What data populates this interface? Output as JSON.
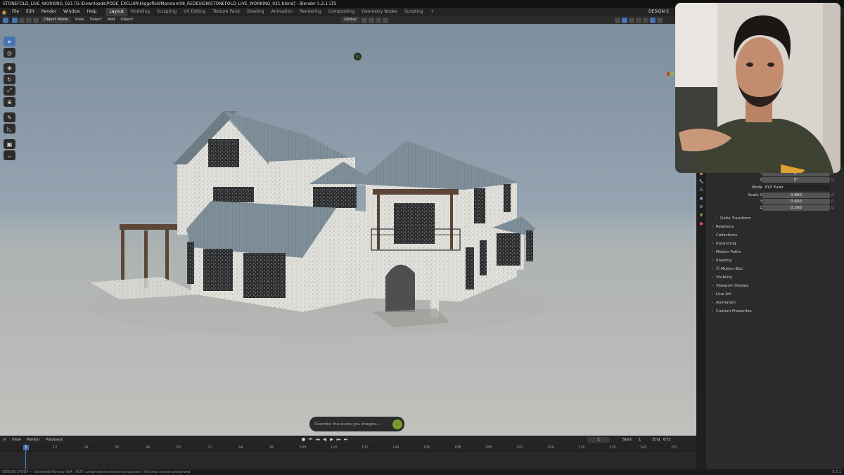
{
  "window": {
    "title": "STONEFOLD_LIVE_WORKING_021 [G:\\Downloads\\PODE_EXCLUIR\\HiggsfieldMansion\\08_REDESIGN\\STONEFOLD_LIVE_WORKING_021.blend] - Blender 5.2.1 LTS"
  },
  "menu": {
    "items": [
      "File",
      "Edit",
      "Render",
      "Window",
      "Help"
    ],
    "workspaces": [
      "Layout",
      "Modeling",
      "Sculpting",
      "UV Editing",
      "Texture Paint",
      "Shading",
      "Animation",
      "Rendering",
      "Compositing",
      "Geometry Nodes",
      "Scripting"
    ],
    "active_workspace": "Layout",
    "add_tab": "+",
    "right_label": "DESIGN S"
  },
  "viewport_header": {
    "mode": "Object Mode",
    "menus": [
      "View",
      "Select",
      "Add",
      "Object"
    ],
    "orientation": "Global"
  },
  "prompt": {
    "placeholder": "Describe the scene you imagine...",
    "submit_icon": "arrow-right-icon"
  },
  "timeline": {
    "menus": [
      "View",
      "Marker",
      "Playback"
    ],
    "current_frame": "1",
    "start_label": "Start",
    "start": "1",
    "end_label": "End",
    "end": "673",
    "ticks": [
      "1",
      "12",
      "24",
      "36",
      "48",
      "60",
      "72",
      "84",
      "96",
      "108",
      "120",
      "132",
      "144",
      "156",
      "168",
      "180",
      "192",
      "204",
      "216",
      "228",
      "240",
      "252"
    ]
  },
  "status": {
    "text": "DESIGN STUDY — Stonefold Review 004 | NOT completed furnished production | Original scenes preserved",
    "version": "5.2.1"
  },
  "properties": {
    "rot_y_label": "Y",
    "rot_y": "0°",
    "rot_z_label": "Z",
    "rot_z": "0°",
    "mode_label": "Mode",
    "mode_value": "XYZ Euler",
    "scale_x_label": "Scale X",
    "scale_x": "0.800",
    "scale_y_label": "Y",
    "scale_y": "0.650",
    "scale_z_label": "Z",
    "scale_z": "0.500",
    "delta": "Delta Transform",
    "sections": [
      "Relations",
      "Collections",
      "Instancing",
      "Motion Paths",
      "Shading",
      "Motion Blur",
      "Visibility",
      "Viewport Display",
      "Line Art",
      "Animation",
      "Custom Properties"
    ]
  },
  "colors": {
    "accent": "#4772b3",
    "panel": "#2b2b2b",
    "header": "#232323",
    "prompt_button": "#7b9b2a"
  }
}
